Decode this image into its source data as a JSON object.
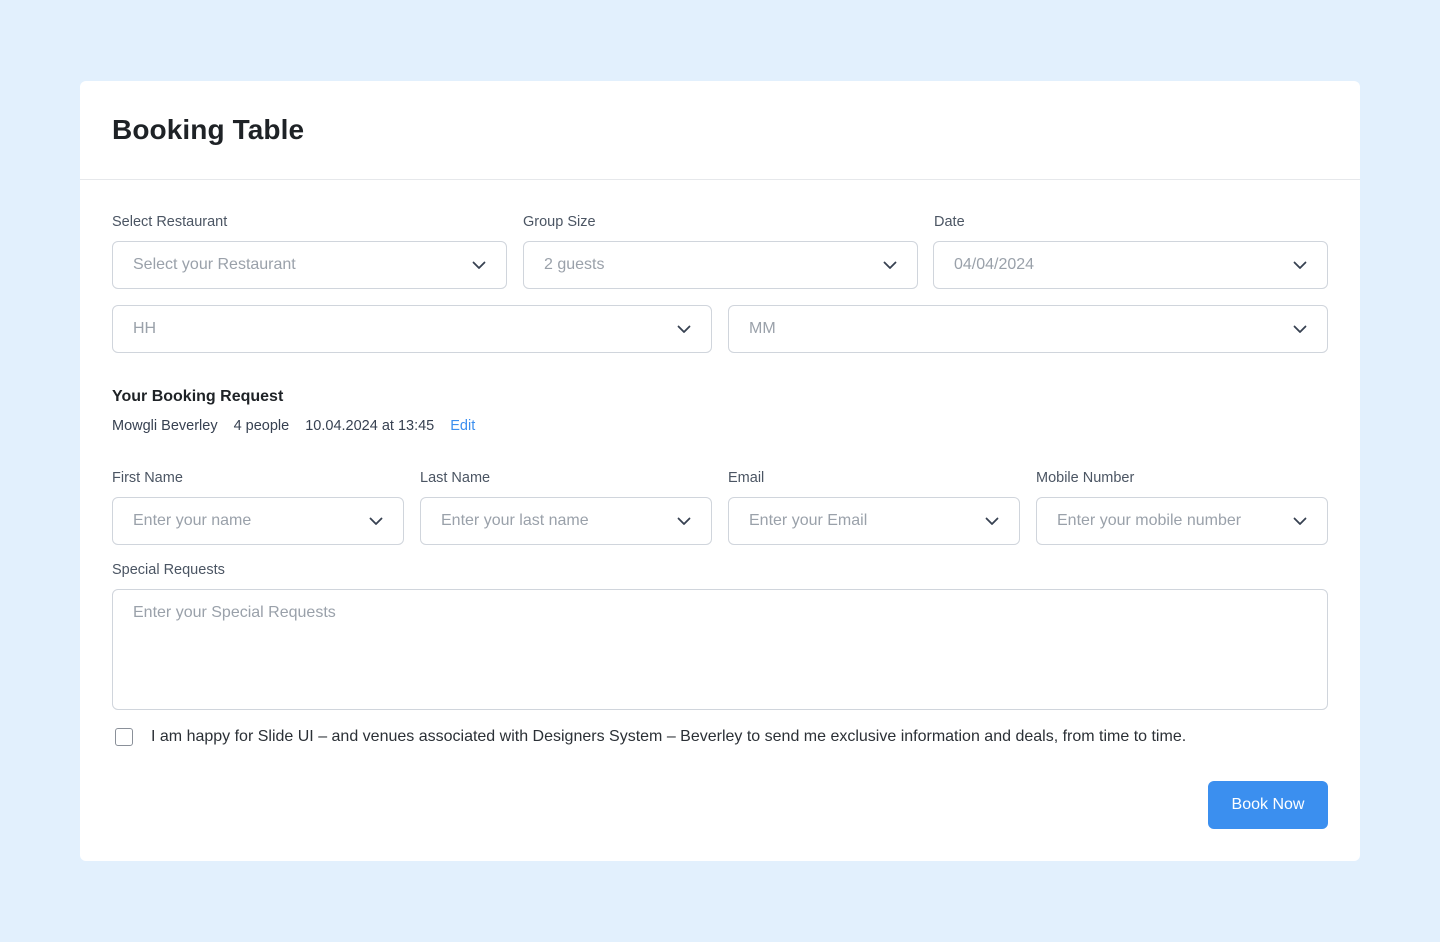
{
  "card": {
    "title": "Booking Table"
  },
  "reservation": {
    "restaurant": {
      "label": "Select Restaurant",
      "placeholder": "Select your Restaurant"
    },
    "group_size": {
      "label": "Group Size",
      "value": "2 guests"
    },
    "date": {
      "label": "Date",
      "value": "04/04/2024"
    },
    "hour": {
      "placeholder": "HH"
    },
    "minute": {
      "placeholder": "MM"
    }
  },
  "booking_request": {
    "title": "Your Booking Request",
    "name": "Mowgli Beverley",
    "people": "4 people",
    "datetime": "10.04.2024 at 13:45",
    "edit_label": "Edit"
  },
  "contact": {
    "first_name": {
      "label": "First Name",
      "placeholder": "Enter your name"
    },
    "last_name": {
      "label": "Last Name",
      "placeholder": "Enter your last name"
    },
    "email": {
      "label": "Email",
      "placeholder": "Enter your Email"
    },
    "mobile": {
      "label": "Mobile Number",
      "placeholder": "Enter your mobile number"
    }
  },
  "special_requests": {
    "label": "Special Requests",
    "placeholder": "Enter your Special Requests"
  },
  "consent": {
    "checked": false,
    "text": "I am happy for Slide UI – and venues associated with Designers System  – Beverley to send me exclusive information and deals, from time to time."
  },
  "submit": {
    "label": "Book Now"
  },
  "icons": {
    "dropdown": "chevron-down-icon"
  },
  "colors": {
    "page_background": "#e2f0fd",
    "accent": "#3b8fef"
  }
}
